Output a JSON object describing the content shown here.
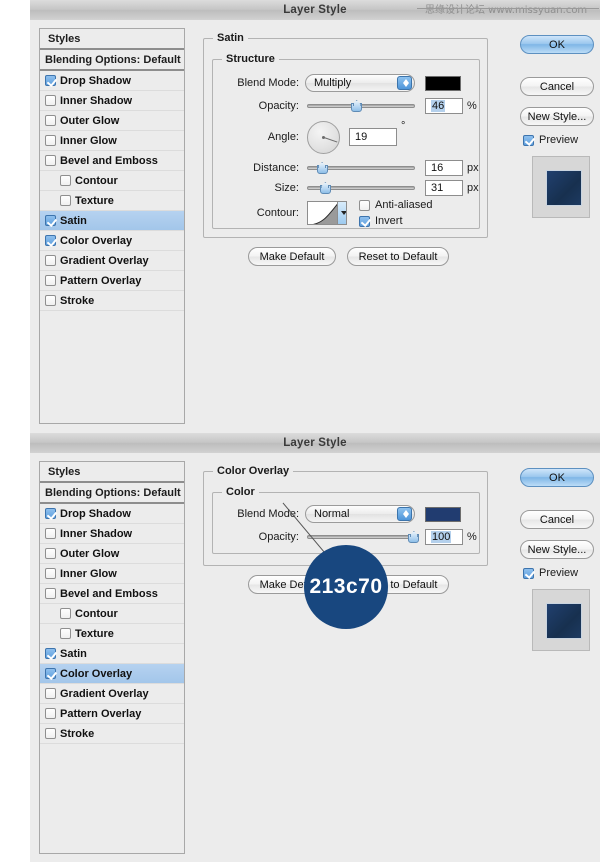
{
  "watermark": "思缘设计论坛 www.missyuan.com",
  "styles_panel": {
    "header": "Styles",
    "blending_options": "Blending Options: Default",
    "items": [
      {
        "label": "Drop Shadow",
        "checked": true,
        "indent": false
      },
      {
        "label": "Inner Shadow",
        "checked": false,
        "indent": false
      },
      {
        "label": "Outer Glow",
        "checked": false,
        "indent": false
      },
      {
        "label": "Inner Glow",
        "checked": false,
        "indent": false
      },
      {
        "label": "Bevel and Emboss",
        "checked": false,
        "indent": false
      },
      {
        "label": "Contour",
        "checked": false,
        "indent": true
      },
      {
        "label": "Texture",
        "checked": false,
        "indent": true
      },
      {
        "label": "Satin",
        "checked": true,
        "indent": false
      },
      {
        "label": "Color Overlay",
        "checked": true,
        "indent": false
      },
      {
        "label": "Gradient Overlay",
        "checked": false,
        "indent": false
      },
      {
        "label": "Pattern Overlay",
        "checked": false,
        "indent": false
      },
      {
        "label": "Stroke",
        "checked": false,
        "indent": false
      }
    ]
  },
  "buttons": {
    "ok": "OK",
    "cancel": "Cancel",
    "new_style": "New Style...",
    "preview": "Preview",
    "make_default": "Make Default",
    "reset_to_default": "Reset to Default"
  },
  "dialog1": {
    "title": "Layer Style",
    "selected_style": "Satin",
    "group_title": "Satin",
    "subgroup_title": "Structure",
    "labels": {
      "blend_mode": "Blend Mode:",
      "opacity": "Opacity:",
      "angle": "Angle:",
      "distance": "Distance:",
      "size": "Size:",
      "contour": "Contour:",
      "anti_aliased": "Anti-aliased",
      "invert": "Invert"
    },
    "values": {
      "blend_mode": "Multiply",
      "blend_color": "#000000",
      "opacity": "46",
      "opacity_unit": "%",
      "angle": "19",
      "angle_unit": "°",
      "distance": "16",
      "distance_unit": "px",
      "size": "31",
      "size_unit": "px",
      "anti_aliased_checked": false,
      "invert_checked": true
    },
    "preview_color": "#1b3560"
  },
  "dialog2": {
    "title": "Layer Style",
    "selected_style": "Color Overlay",
    "group_title": "Color Overlay",
    "subgroup_title": "Color",
    "labels": {
      "blend_mode": "Blend Mode:",
      "opacity": "Opacity:"
    },
    "values": {
      "blend_mode": "Normal",
      "blend_color": "#213c70",
      "opacity": "100",
      "opacity_unit": "%"
    },
    "preview_color": "#1b3560"
  },
  "callout": {
    "text": "213c70",
    "color": "#18477f"
  }
}
